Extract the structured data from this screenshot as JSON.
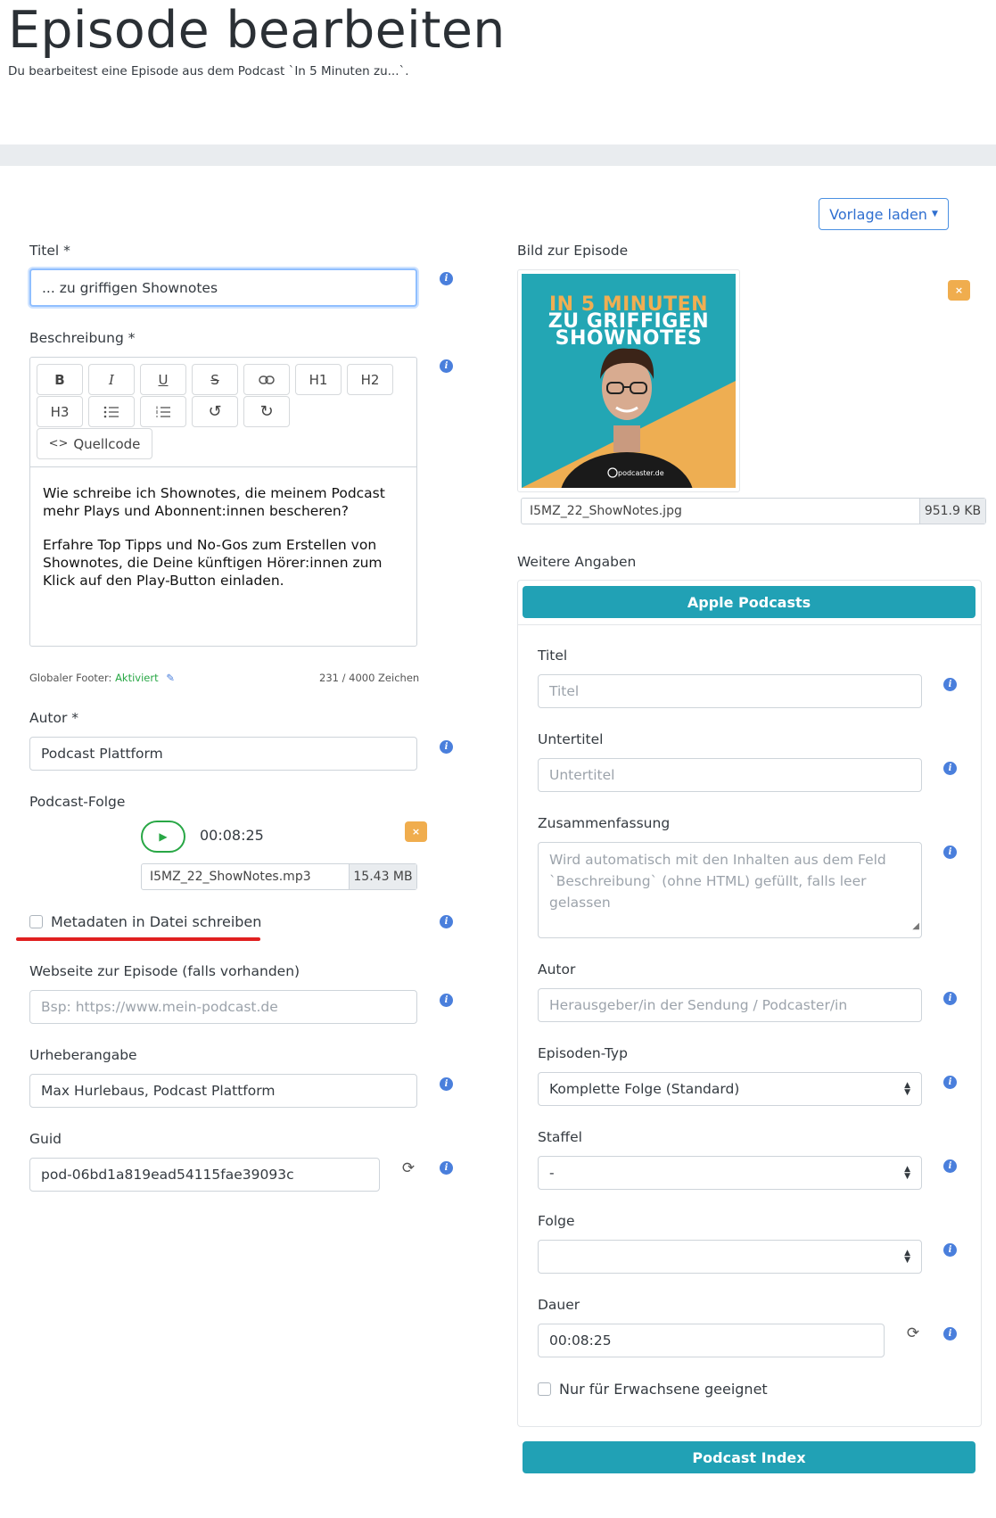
{
  "header": {
    "title": "Episode bearbeiten",
    "subtitle": "Du bearbeitest eine Episode aus dem Podcast `In 5 Minuten zu...`."
  },
  "toolbar": {
    "template_button": "Vorlage laden"
  },
  "left": {
    "title_label": "Titel *",
    "title_value": "... zu griffigen Shownotes",
    "description_label": "Beschreibung *",
    "editor_buttons": [
      "B",
      "I",
      "U",
      "S",
      "link",
      "H1",
      "H2",
      "H3",
      "ul",
      "ol",
      "undo",
      "redo"
    ],
    "source_button": "Quellcode",
    "description_p1": "Wie schreibe ich Shownotes, die meinem Podcast mehr Plays und Abonnent:innen bescheren?",
    "description_p2": "Erfahre Top Tipps und No-Gos zum Erstellen von Shownotes, die Deine künftigen Hörer:innen zum Klick auf den Play-Button einladen.",
    "footer_label": "Globaler Footer:",
    "footer_status": "Aktiviert",
    "char_count": "231 / 4000 Zeichen",
    "author_label": "Autor *",
    "author_value": "Podcast Plattform",
    "episode_label": "Podcast-Folge",
    "audio_time": "00:08:25",
    "audio_file": "I5MZ_22_ShowNotes.mp3",
    "audio_size": "15.43 MB",
    "metadata_label": "Metadaten in Datei schreiben",
    "website_label": "Webseite zur Episode (falls vorhanden)",
    "website_placeholder": "Bsp: https://www.mein-podcast.de",
    "copyright_label": "Urheberangabe",
    "copyright_value": "Max Hurlebaus, Podcast Plattform",
    "guid_label": "Guid",
    "guid_value": "pod-06bd1a819ead54115fae39093c"
  },
  "right": {
    "image_label": "Bild zur Episode",
    "cover_lines": [
      "IN 5 MINUTEN",
      "ZU GRIFFIGEN",
      "SHOWNOTES"
    ],
    "cover_logo": "podcaster.de",
    "image_file": "I5MZ_22_ShowNotes.jpg",
    "image_size": "951.9 KB",
    "more_label": "Weitere Angaben",
    "apple_button": "Apple Podcasts",
    "apple_title_label": "Titel",
    "apple_title_placeholder": "Titel",
    "subtitle_label": "Untertitel",
    "subtitle_placeholder": "Untertitel",
    "summary_label": "Zusammenfassung",
    "summary_placeholder": "Wird automatisch mit den Inhalten aus dem Feld `Beschreibung` (ohne HTML) gefüllt, falls leer gelassen",
    "apple_author_label": "Autor",
    "apple_author_placeholder": "Herausgeber/in der Sendung / Podcaster/in",
    "type_label": "Episoden-Typ",
    "type_value": "Komplette Folge (Standard)",
    "season_label": "Staffel",
    "season_value": "-",
    "episode_label": "Folge",
    "episode_value": "",
    "duration_label": "Dauer",
    "duration_value": "00:08:25",
    "explicit_label": "Nur für Erwachsene geeignet",
    "index_button": "Podcast Index"
  },
  "colors": {
    "teal": "#21a1b5",
    "info": "#4a7fdc",
    "orange": "#f0ad4e",
    "active_green": "#28a745",
    "cover_orange": "#eeae52"
  },
  "icons": [
    "info-icon",
    "refresh-icon",
    "close-icon",
    "play-icon",
    "pencil-icon",
    "caret-down-icon",
    "select-arrows-icon"
  ]
}
